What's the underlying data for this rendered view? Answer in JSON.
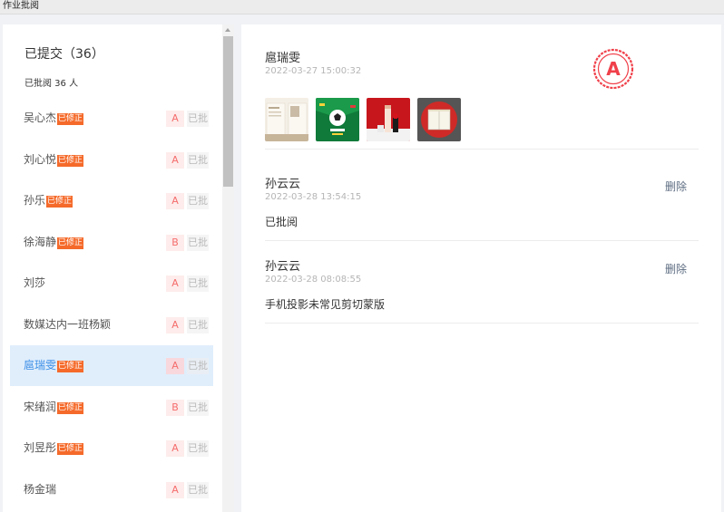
{
  "window": {
    "title": "作业批阅"
  },
  "sidebar": {
    "heading": "已提交（36）",
    "reviewed_count": "已批阅 36 人",
    "tag_label": "已修正",
    "done_label": "已批",
    "rows": [
      {
        "name": "吴心杰",
        "tag": "已修正",
        "grade": "A",
        "status": "已批"
      },
      {
        "name": "刘心悦",
        "tag": "已修正",
        "grade": "A",
        "status": "已批"
      },
      {
        "name": "孙乐",
        "tag": "已修正",
        "grade": "A",
        "status": "已批"
      },
      {
        "name": "徐海静",
        "tag": "已修正",
        "grade": "B",
        "status": "已批"
      },
      {
        "name": "刘莎",
        "tag": "",
        "grade": "A",
        "status": "已批"
      },
      {
        "name": "数媒达内一班杨颖",
        "tag": "",
        "grade": "A",
        "status": "已批"
      },
      {
        "name": "扈瑞雯",
        "tag": "已修正",
        "grade": "A",
        "status": "已批",
        "selected": true
      },
      {
        "name": "宋绪润",
        "tag": "已修正",
        "grade": "B",
        "status": "已批"
      },
      {
        "name": "刘昱彤",
        "tag": "已修正",
        "grade": "A",
        "status": "已批"
      },
      {
        "name": "杨金瑞",
        "tag": "",
        "grade": "A",
        "status": "已批"
      }
    ]
  },
  "detail": {
    "student_name": "扈瑞雯",
    "submitted_at": "2022-03-27 15:00:32",
    "grade_stamp": "A",
    "stamp_color": "#f0404a",
    "attachments": [
      {
        "icon": "brochure-thumbnail"
      },
      {
        "icon": "football-poster-thumbnail"
      },
      {
        "icon": "cosmetics-thumbnail"
      },
      {
        "icon": "notebook-thumbnail"
      }
    ],
    "comments": [
      {
        "author": "孙云云",
        "time": "2022-03-28 13:54:15",
        "text": "已批阅",
        "delete_label": "删除"
      },
      {
        "author": "孙云云",
        "time": "2022-03-28 08:08:55",
        "text": "手机投影未常见剪切蒙版",
        "delete_label": "删除"
      }
    ]
  },
  "colors": {
    "accent": "#3a8ee6",
    "tag_bg": "#f56a2a",
    "grade_text": "#f56c6c"
  }
}
